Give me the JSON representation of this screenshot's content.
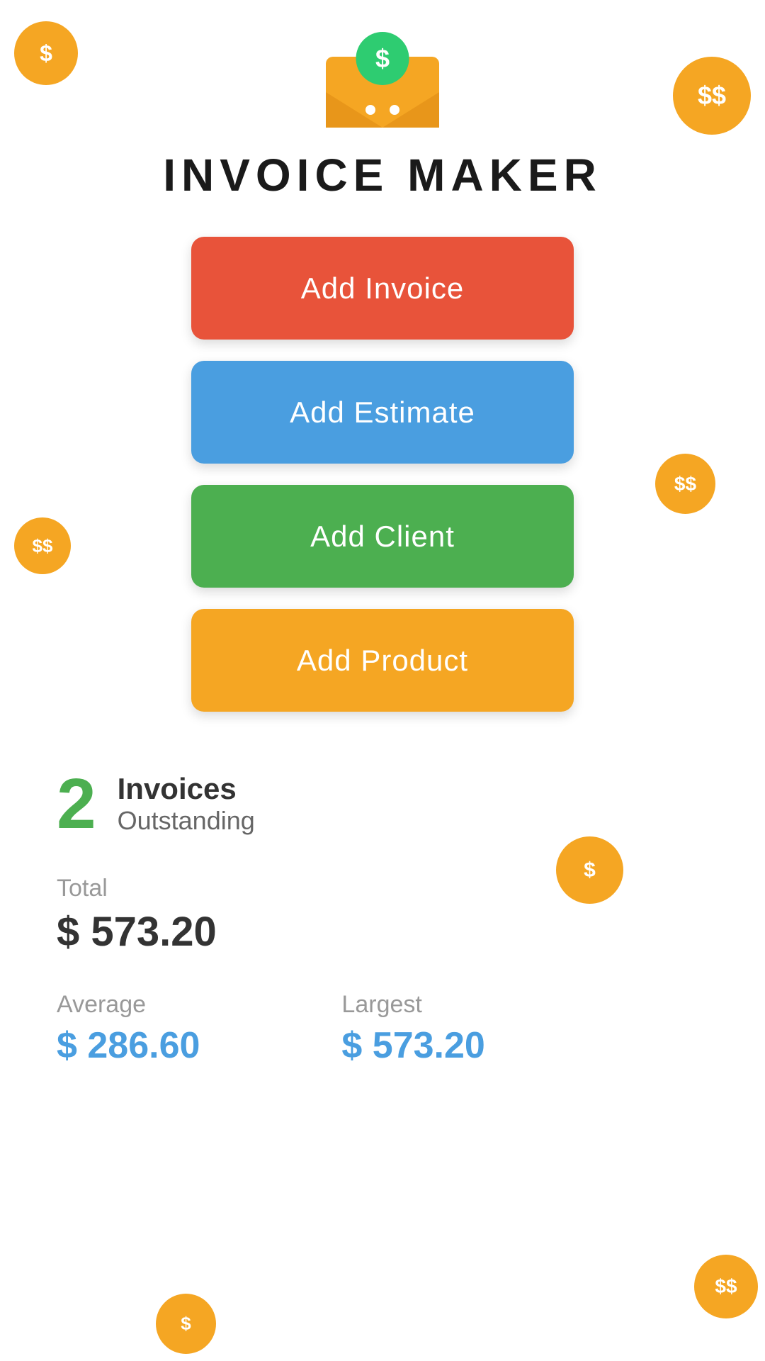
{
  "app": {
    "title": "INVOICE MAKER"
  },
  "buttons": {
    "add_invoice": "Add Invoice",
    "add_estimate": "Add Estimate",
    "add_client": "Add Client",
    "add_product": "Add Product"
  },
  "stats": {
    "outstanding_count": "2",
    "outstanding_label_1": "Invoices",
    "outstanding_label_2": "Outstanding",
    "total_label": "Total",
    "total_value": "$ 573.20",
    "average_label": "Average",
    "average_value": "$ 286.60",
    "largest_label": "Largest",
    "largest_value": "$ 573.20"
  },
  "coins": {
    "symbol": "$",
    "double_symbol": "$$"
  },
  "colors": {
    "orange": "#F5A623",
    "red": "#E8533A",
    "blue": "#4A9EE0",
    "green": "#4CAF50",
    "teal_text": "#4A9EE0"
  }
}
